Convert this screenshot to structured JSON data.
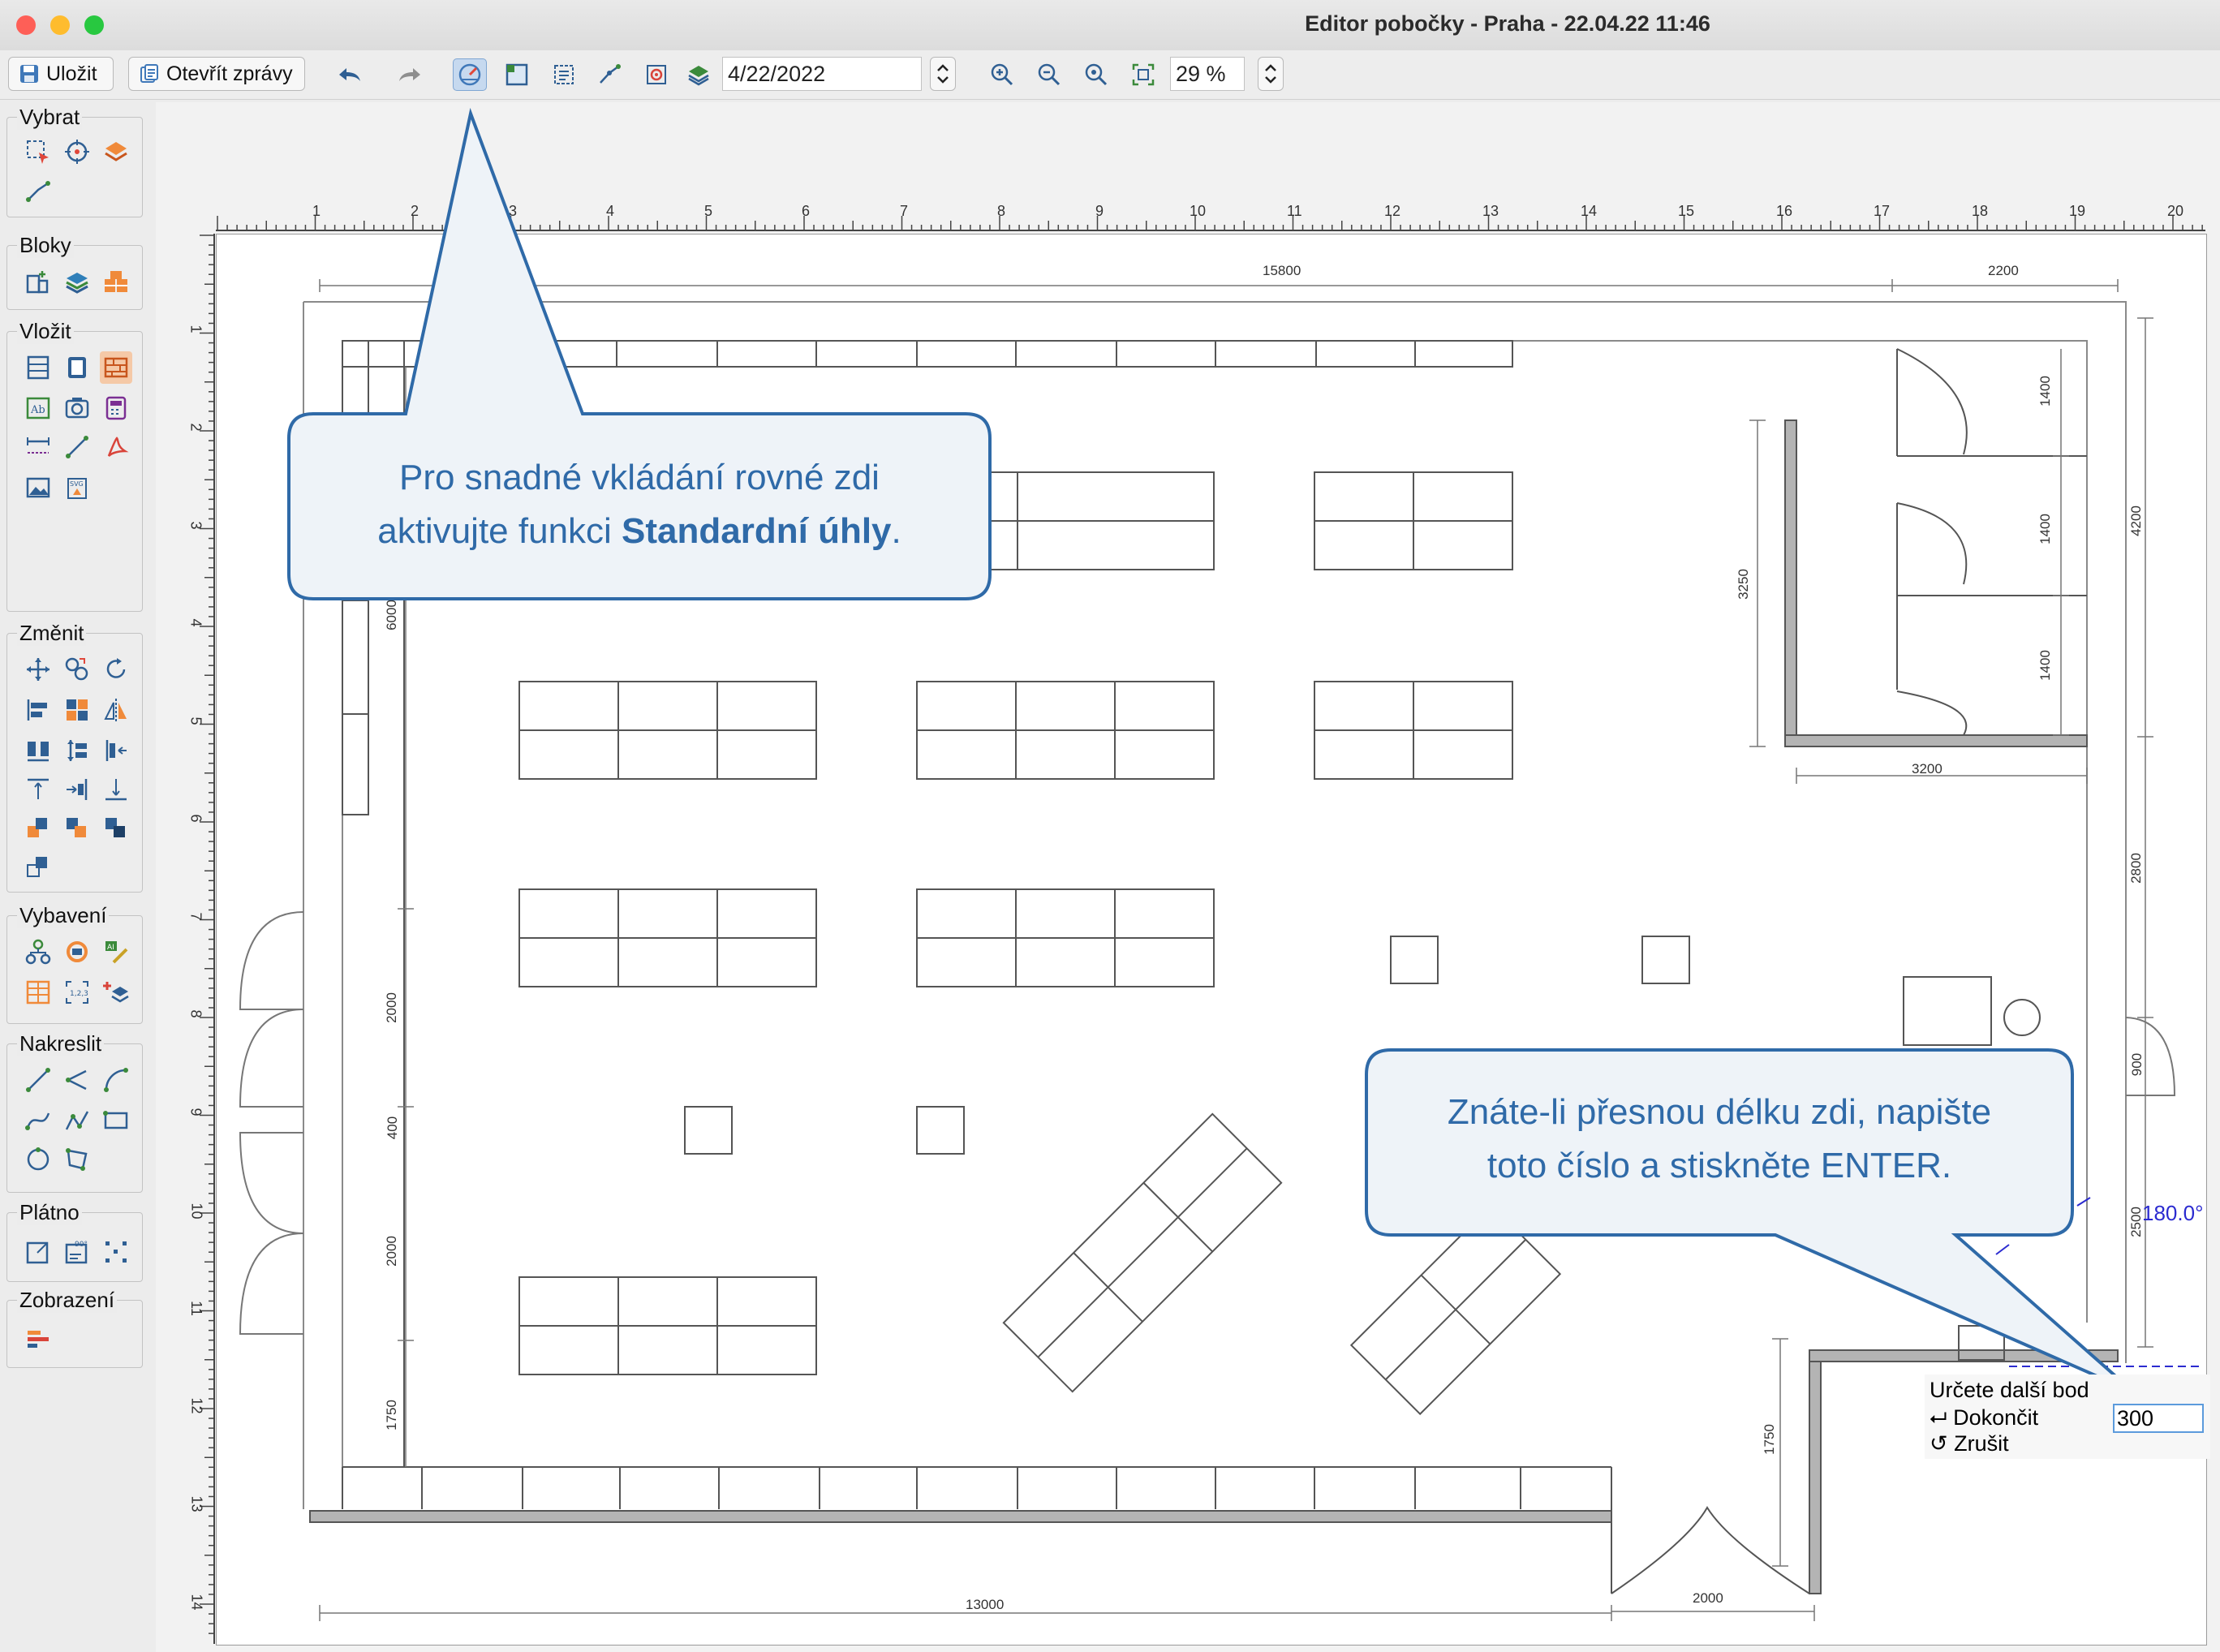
{
  "window": {
    "title": "Editor pobočky - Praha - 22.04.22 11:46",
    "lights": [
      "#fe5f57",
      "#febc2e",
      "#28c840"
    ]
  },
  "toolbar": {
    "save_label": "Uložit",
    "open_reports_label": "Otevřít zprávy",
    "date_value": "4/22/2022",
    "zoom_value": "29 %",
    "active_tool": "standard-angles"
  },
  "palette": {
    "groups": [
      {
        "label": "Vybrat"
      },
      {
        "label": "Bloky"
      },
      {
        "label": "Vložit"
      },
      {
        "label": "Změnit"
      },
      {
        "label": "Vybavení"
      },
      {
        "label": "Nakreslit"
      },
      {
        "label": "Plátno"
      },
      {
        "label": "Zobrazení"
      }
    ]
  },
  "ruler": {
    "top": [
      "1",
      "2",
      "3",
      "4",
      "5",
      "6",
      "7",
      "8",
      "9",
      "10",
      "11",
      "12",
      "13",
      "14",
      "15",
      "16",
      "17",
      "18",
      "19",
      "20"
    ],
    "left": [
      "1",
      "2",
      "3",
      "4",
      "5",
      "6",
      "7",
      "8",
      "9",
      "10",
      "11",
      "12",
      "13",
      "14"
    ]
  },
  "dimensions": {
    "top_main": "15800",
    "top_right": "2200",
    "left_6000": "6000",
    "left_2000a": "2000",
    "left_400": "400",
    "left_2000b": "2000",
    "left_1750": "1750",
    "room_3250": "3250",
    "room_3200": "3200",
    "right_1400a": "1400",
    "right_1400b": "1400",
    "right_1400c": "1400",
    "right_4200": "4200",
    "right_2800": "2800",
    "right_900": "900",
    "right_2500": "2500",
    "entry_1750": "1750",
    "bottom_13000": "13000",
    "bottom_2000": "2000",
    "angle": "180.0°"
  },
  "callouts": {
    "top": {
      "line1": "Pro snadné vkládání rovné zdi",
      "line2_pre": "aktivujte funkci ",
      "line2_bold": "Standardní úhly",
      "line2_post": "."
    },
    "bottom": {
      "line1": "Znáte-li přesnou délku zdi, napište",
      "line2": "toto číslo a stiskněte ENTER."
    }
  },
  "prompt": {
    "title": "Určete další bod",
    "finish": "Dokončit",
    "cancel": "Zrušit",
    "input_value": "300"
  },
  "colors": {
    "accent": "#2f6aa8",
    "callout_fill": "#eef3f8",
    "wall": "#b4b4b4",
    "selected_tool": "#f5c9a7"
  }
}
